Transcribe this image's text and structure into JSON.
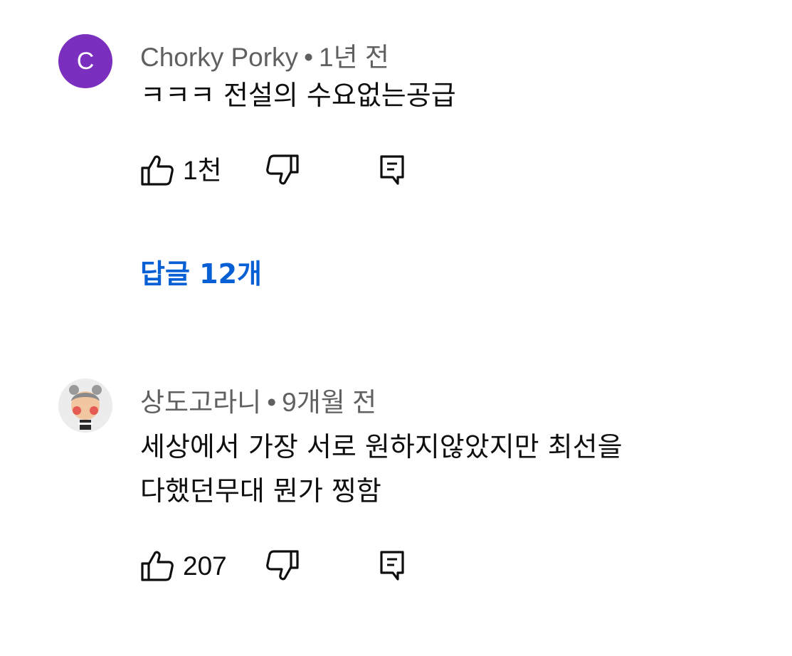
{
  "comments": [
    {
      "avatar_letter": "C",
      "avatar_color": "#7b2fbe",
      "author": "Chorky Porky",
      "separator": "•",
      "time": "1년 전",
      "text_lines": [
        "ㅋㅋㅋ 전설의 수요없는공급"
      ],
      "likes": "1천",
      "replies_label": "답글 12개"
    },
    {
      "author": "상도고라니",
      "separator": "•",
      "time": "9개월 전",
      "text_lines": [
        "세상에서 가장 서로 원하지않았지만  최선을",
        "다했던무대 뭔가 찡함"
      ],
      "likes": "207"
    }
  ],
  "colors": {
    "reply_link": "#065fd4",
    "meta_gray": "#606060"
  },
  "icons": [
    "like-icon",
    "dislike-icon",
    "reply-icon"
  ]
}
